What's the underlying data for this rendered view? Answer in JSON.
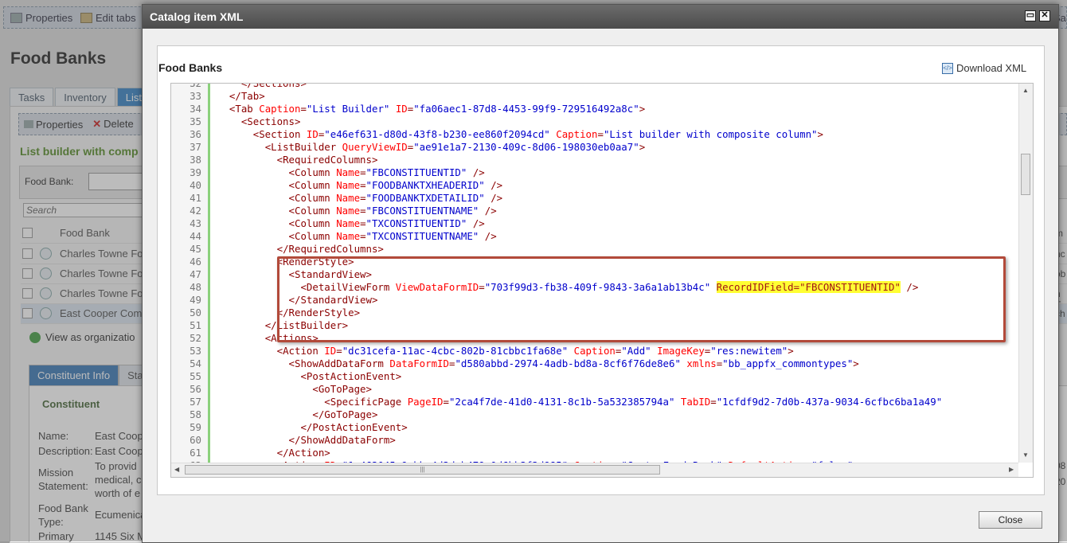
{
  "background": {
    "toolbar": {
      "properties": "Properties",
      "edit_tabs": "Edit tabs",
      "sa": "Sa"
    },
    "page_title": "Food Banks",
    "tabs": [
      "Tasks",
      "Inventory",
      "List"
    ],
    "actions": {
      "properties": "Properties",
      "delete": "Delete"
    },
    "list_title": "List builder with comp",
    "filter_label": "Food Bank:",
    "search_placeholder": "Search",
    "grid_header": "Food Bank",
    "rows": [
      "Charles Towne Fo",
      "Charles Towne Fo",
      "Charles Towne Fo",
      "East Cooper Com"
    ],
    "view_as": "View as organizatio",
    "subtabs": [
      "Constituent Info",
      "Sta"
    ],
    "section_title": "Constituent",
    "fields": [
      {
        "label": "Name:",
        "value": "East Coop"
      },
      {
        "label": "Description:",
        "value": "East Coop"
      },
      {
        "label": "Mission",
        "value": "To provid"
      },
      {
        "label": "Statement:",
        "value": "medical, c"
      },
      {
        "label": "",
        "value": "worth of e"
      },
      {
        "label": "Food Bank",
        "value": "Ecumenica"
      },
      {
        "label": "Type:",
        "value": ""
      },
      {
        "label": "Primary",
        "value": "1145 Six Mile Rd"
      }
    ],
    "right_edge": [
      "m",
      "nc",
      "ob",
      "n T",
      "ch",
      "08",
      "20"
    ]
  },
  "modal": {
    "title": "Catalog item XML",
    "body_title": "Food Banks",
    "download_label": "Download XML",
    "close_label": "Close",
    "editor": {
      "line_numbers": [
        "32",
        "33",
        "34",
        "35",
        "36",
        "37",
        "38",
        "39",
        "40",
        "41",
        "42",
        "43",
        "44",
        "45",
        "46",
        "47",
        "48",
        "49",
        "50",
        "51",
        "52",
        "53",
        "54",
        "55",
        "56",
        "57",
        "58",
        "59",
        "60",
        "61",
        "62"
      ],
      "highlight_text": "RecordIDField=\"FBCONSTITUENTID\""
    }
  }
}
